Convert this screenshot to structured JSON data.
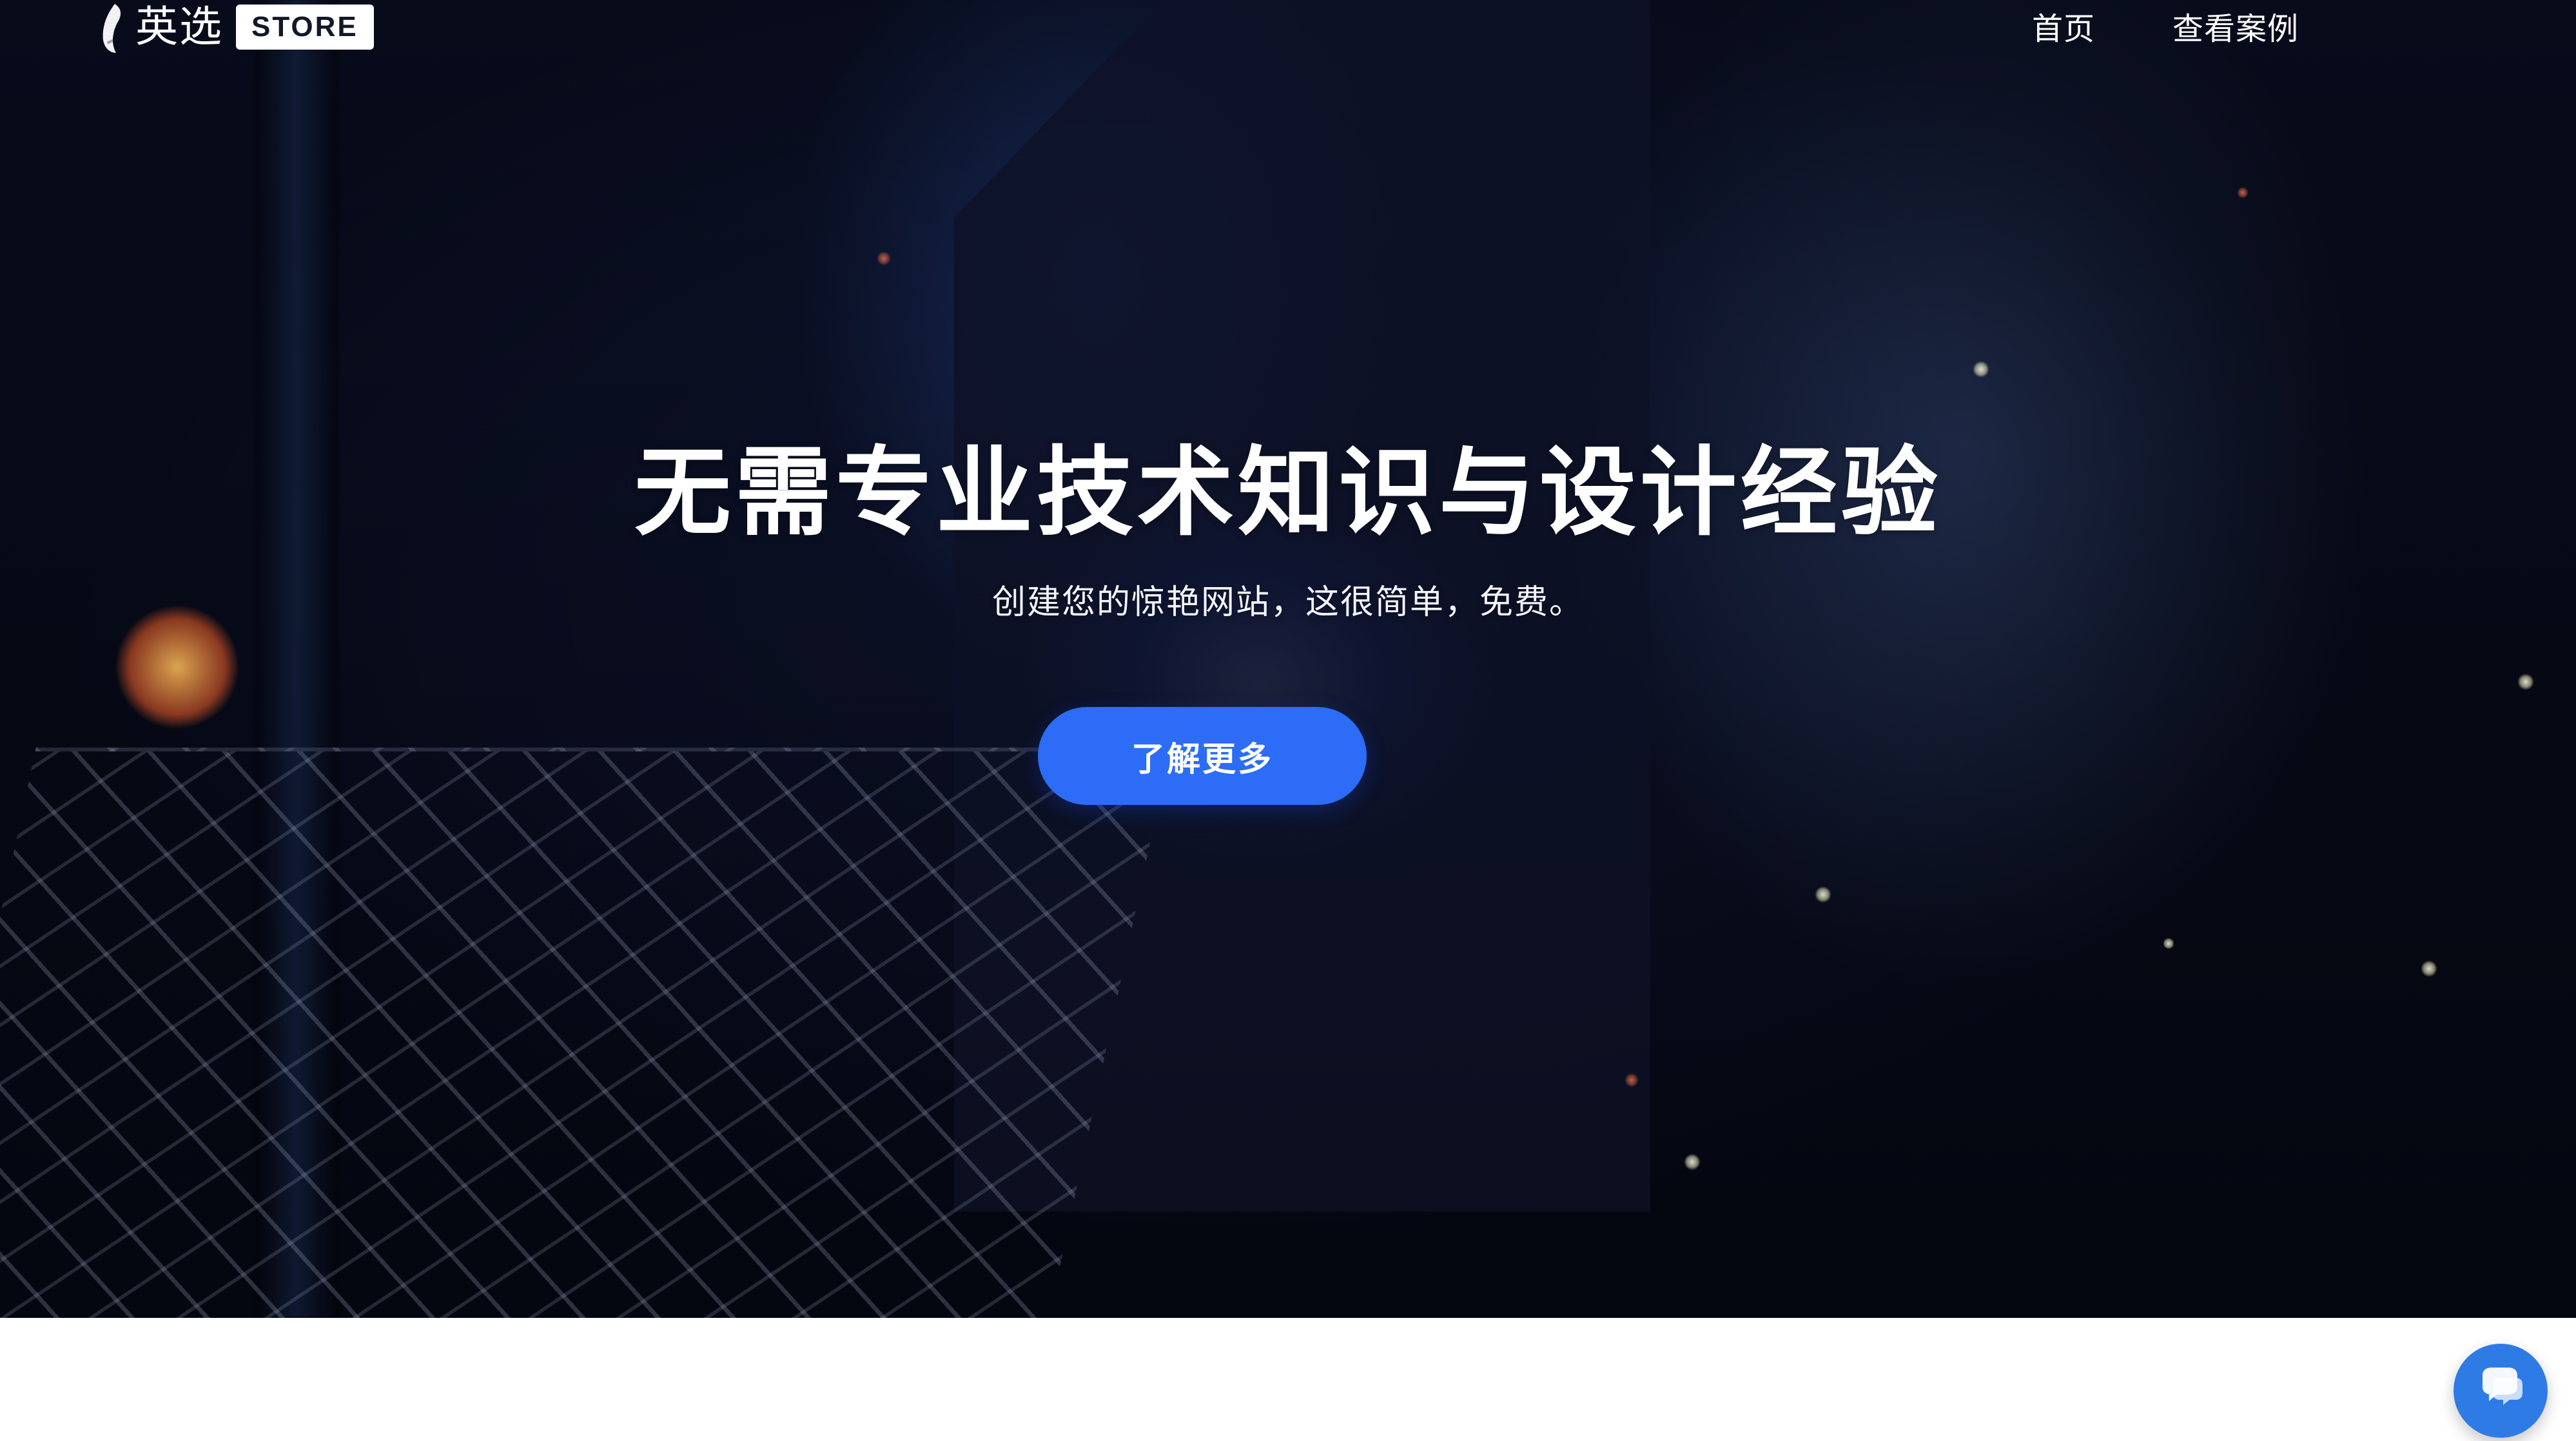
{
  "header": {
    "logo": {
      "brand": "英选",
      "badge": "STORE",
      "icon": "feather-logo-icon"
    },
    "nav": {
      "items": [
        {
          "label": "首页"
        },
        {
          "label": "查看案例"
        }
      ]
    }
  },
  "hero": {
    "title": "无需专业技术知识与设计经验",
    "subtitle": "创建您的惊艳网站，这很简单，免费。",
    "cta_label": "了解更多"
  },
  "widgets": {
    "chat": {
      "icon": "chat-bubbles-icon"
    }
  },
  "colors": {
    "primary": "#2c6cf6",
    "chat_button": "#2f7be6",
    "background_white": "#ffffff",
    "hero_dark": "#0b1026"
  }
}
